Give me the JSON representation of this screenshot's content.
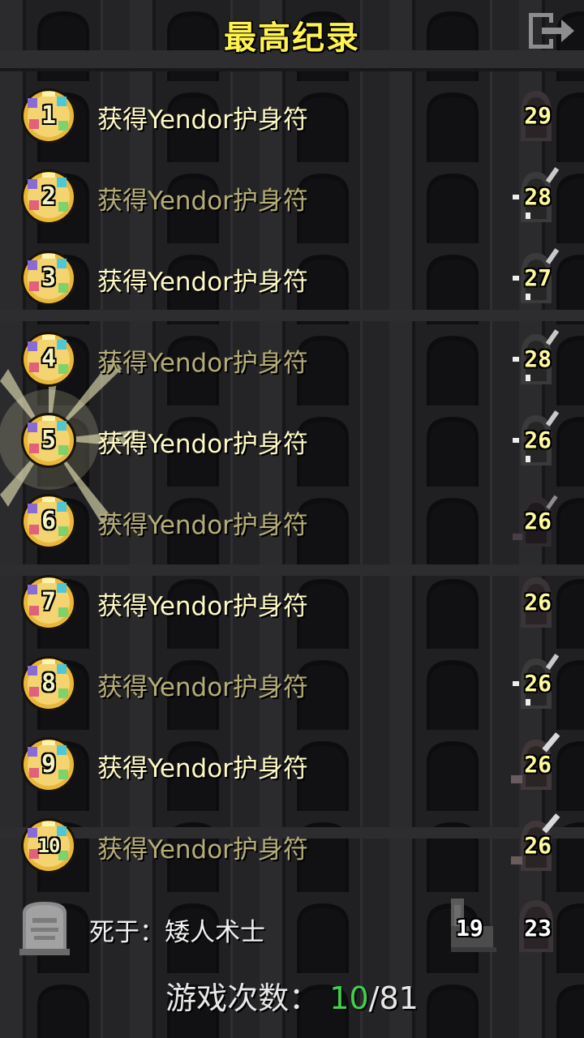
{
  "header": {
    "title": "最高纪录",
    "exit_icon": "exit-door-icon"
  },
  "colors": {
    "title": "#fff44f",
    "won_count": "#3fd24a",
    "bright_text": "#fff9c4",
    "dim_text": "#b6ad76"
  },
  "records": [
    {
      "rank": "1",
      "description": "获得Yendor护身符",
      "level": "29",
      "highlighted": true,
      "hero": "dwarf-hooded"
    },
    {
      "rank": "2",
      "description": "获得Yendor护身符",
      "level": "28",
      "highlighted": false,
      "hero": "huntress"
    },
    {
      "rank": "3",
      "description": "获得Yendor护身符",
      "level": "27",
      "highlighted": true,
      "hero": "huntress"
    },
    {
      "rank": "4",
      "description": "获得Yendor护身符",
      "level": "28",
      "highlighted": false,
      "hero": "huntress"
    },
    {
      "rank": "5",
      "description": "获得Yendor护身符",
      "level": "26",
      "highlighted": true,
      "hero": "huntress",
      "latest": true
    },
    {
      "rank": "6",
      "description": "获得Yendor护身符",
      "level": "26",
      "highlighted": false,
      "hero": "rogue"
    },
    {
      "rank": "7",
      "description": "获得Yendor护身符",
      "level": "26",
      "highlighted": true,
      "hero": "dwarf-hooded"
    },
    {
      "rank": "8",
      "description": "获得Yendor护身符",
      "level": "26",
      "highlighted": false,
      "hero": "huntress"
    },
    {
      "rank": "9",
      "description": "获得Yendor护身符",
      "level": "26",
      "highlighted": true,
      "hero": "warrior"
    },
    {
      "rank": "10",
      "description": "获得Yendor护身符",
      "level": "26",
      "highlighted": false,
      "hero": "warrior"
    }
  ],
  "last_game": {
    "icon": "tombstone-icon",
    "description": "死于：矮人术士",
    "depth_icon": "depth-boot-icon",
    "depth": "19",
    "level": "23",
    "hero": "dwarf-hooded"
  },
  "games": {
    "label": "游戏次数：",
    "won": "10",
    "separator": "/",
    "total": "81"
  }
}
